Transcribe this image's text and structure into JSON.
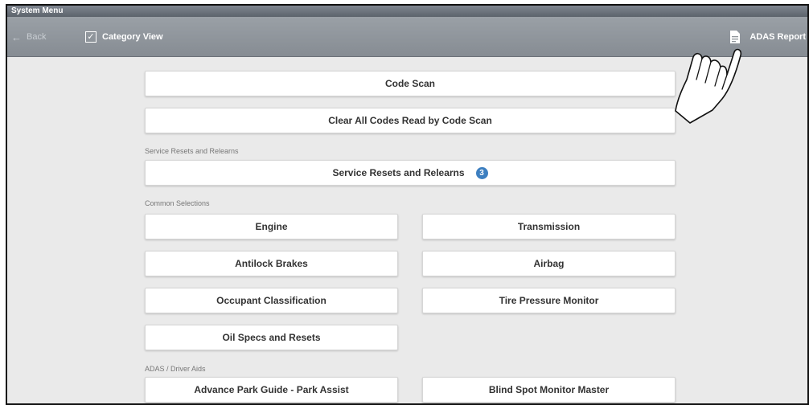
{
  "window": {
    "title": "System Menu"
  },
  "toolbar": {
    "back_label": "Back",
    "category_view_label": "Category View",
    "category_view_checked": true,
    "adas_report_label": "ADAS Report"
  },
  "top_buttons": {
    "code_scan": "Code Scan",
    "clear_codes": "Clear All Codes Read by Code Scan"
  },
  "service": {
    "section_label": "Service Resets and Relearns",
    "button_label": "Service Resets and Relearns",
    "badge_count": "3"
  },
  "common": {
    "section_label": "Common Selections",
    "items": [
      "Engine",
      "Transmission",
      "Antilock Brakes",
      "Airbag",
      "Occupant Classification",
      "Tire Pressure Monitor",
      "Oil Specs and Resets"
    ]
  },
  "adas": {
    "section_label": "ADAS / Driver Aids",
    "items": [
      "Advance Park Guide - Park Assist",
      "Blind Spot Monitor Master"
    ]
  },
  "colors": {
    "toolbar": "#8f959b",
    "badge": "#3d7fc0",
    "background": "#eaeaea"
  }
}
